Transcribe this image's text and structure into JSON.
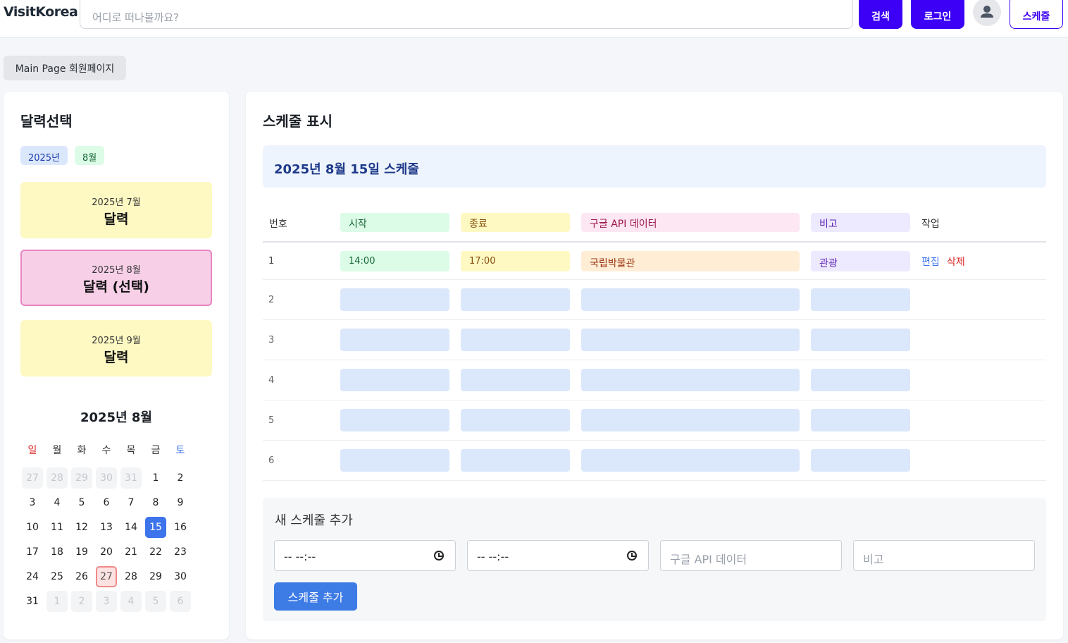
{
  "header": {
    "logo": "VisitKorea",
    "search_placeholder": "어디로 떠나볼까요?",
    "search_button": "검색",
    "login_button": "로그인",
    "schedule_button": "스케줄"
  },
  "breadcrumb": {
    "label": "Main Page 회원페이지"
  },
  "calendar_panel": {
    "title": "달력선택",
    "year_badge": "2025년",
    "month_badge": "8월",
    "months": [
      {
        "sub": "2025년 7월",
        "main": "달력",
        "selected": false
      },
      {
        "sub": "2025년 8월",
        "main": "달력 (선택)",
        "selected": true
      },
      {
        "sub": "2025년 9월",
        "main": "달력",
        "selected": false
      }
    ],
    "calendar_title": "2025년 8월",
    "weekdays": [
      "일",
      "월",
      "화",
      "수",
      "목",
      "금",
      "토"
    ],
    "weeks": [
      [
        "27",
        "28",
        "29",
        "30",
        "31",
        "1",
        "2"
      ],
      [
        "3",
        "4",
        "5",
        "6",
        "7",
        "8",
        "9"
      ],
      [
        "10",
        "11",
        "12",
        "13",
        "14",
        "15",
        "16"
      ],
      [
        "17",
        "18",
        "19",
        "20",
        "21",
        "22",
        "23"
      ],
      [
        "24",
        "25",
        "26",
        "27",
        "28",
        "29",
        "30"
      ],
      [
        "31",
        "1",
        "2",
        "3",
        "4",
        "5",
        "6"
      ]
    ],
    "selected_day": "15",
    "today_day": "27"
  },
  "schedule_panel": {
    "title": "스케줄 표시",
    "date_heading": "2025년 8월 15일 스케줄",
    "columns": [
      "번호",
      "시작",
      "종료",
      "구글 API 데이터",
      "비고",
      "작업"
    ],
    "rows": [
      {
        "no": "1",
        "start": "14:00",
        "end": "17:00",
        "place": "국립박물관",
        "note": "관광",
        "edit": "편집",
        "delete": "삭제"
      },
      {
        "no": "2"
      },
      {
        "no": "3"
      },
      {
        "no": "4"
      },
      {
        "no": "5"
      },
      {
        "no": "6"
      }
    ]
  },
  "add_form": {
    "title": "새 스케줄 추가",
    "start_time": "-- --:--",
    "end_time": "-- --:--",
    "place_placeholder": "구글 API 데이터",
    "note_placeholder": "비고",
    "submit": "스케줄 추가"
  },
  "colors": {
    "brand": "#3b00f5",
    "accent_blue": "#3d74eb",
    "start_bg": "#dcfce7",
    "end_bg": "#fef9c3",
    "place_bg": "#fce7f3",
    "note_bg": "#ede9fe",
    "empty_bg": "#dbe7fb",
    "month_card_bg": "#fef9c3",
    "month_card_selected_bg": "#f7d0e8"
  }
}
